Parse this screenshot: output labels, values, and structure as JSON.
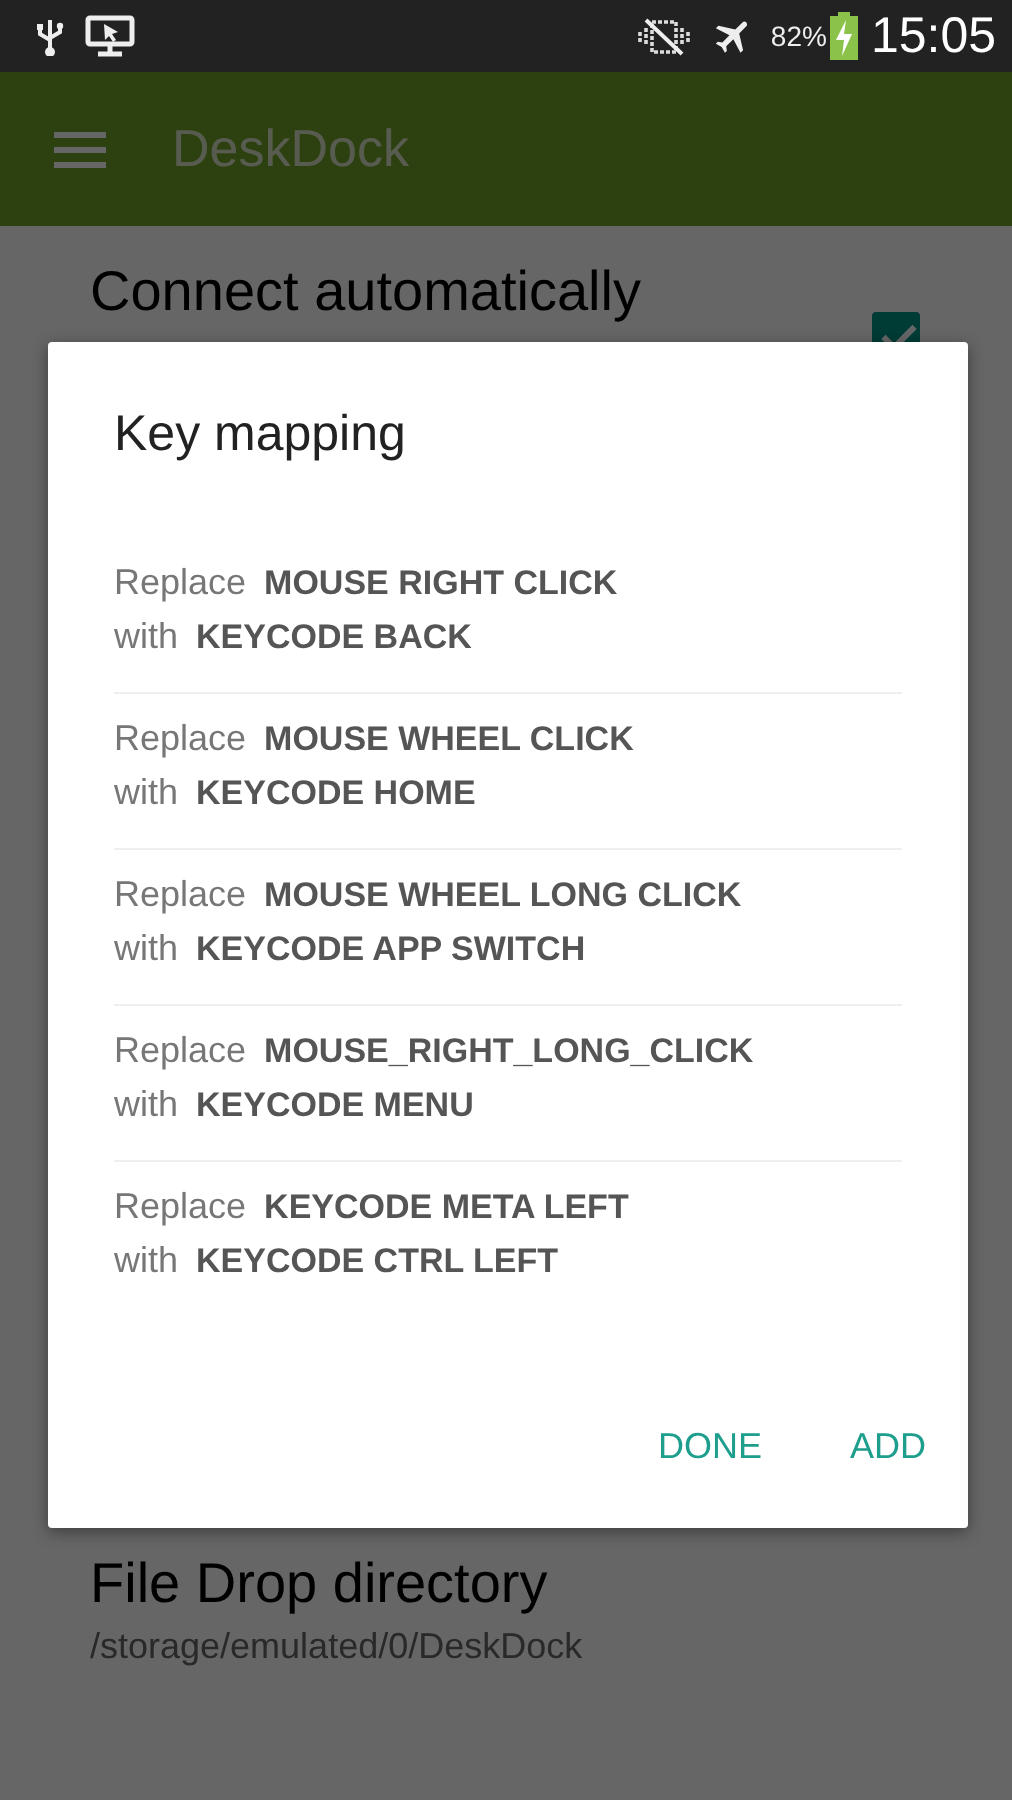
{
  "status_bar": {
    "battery": "82%",
    "time": "15:05"
  },
  "app_bar": {
    "title": "DeskDock"
  },
  "settings": [
    {
      "kind": "checkbox",
      "title": "Connect automatically",
      "checked": true
    },
    {
      "kind": "text",
      "title": "File Drop directory",
      "summary": "/storage/emulated/0/DeskDock"
    }
  ],
  "dialog": {
    "title": "Key mapping",
    "mappings": [
      {
        "replace_label": "Replace",
        "source": "MOUSE RIGHT CLICK",
        "with_label": "with",
        "target": "KEYCODE BACK"
      },
      {
        "replace_label": "Replace",
        "source": "MOUSE WHEEL CLICK",
        "with_label": "with",
        "target": "KEYCODE HOME"
      },
      {
        "replace_label": "Replace",
        "source": "MOUSE WHEEL LONG CLICK",
        "with_label": "with",
        "target": "KEYCODE APP SWITCH"
      },
      {
        "replace_label": "Replace",
        "source": "MOUSE_RIGHT_LONG_CLICK",
        "with_label": "with",
        "target": "KEYCODE MENU"
      },
      {
        "replace_label": "Replace",
        "source": "KEYCODE META LEFT",
        "with_label": "with",
        "target": "KEYCODE CTRL LEFT"
      }
    ],
    "buttons": [
      "DONE",
      "ADD"
    ]
  }
}
